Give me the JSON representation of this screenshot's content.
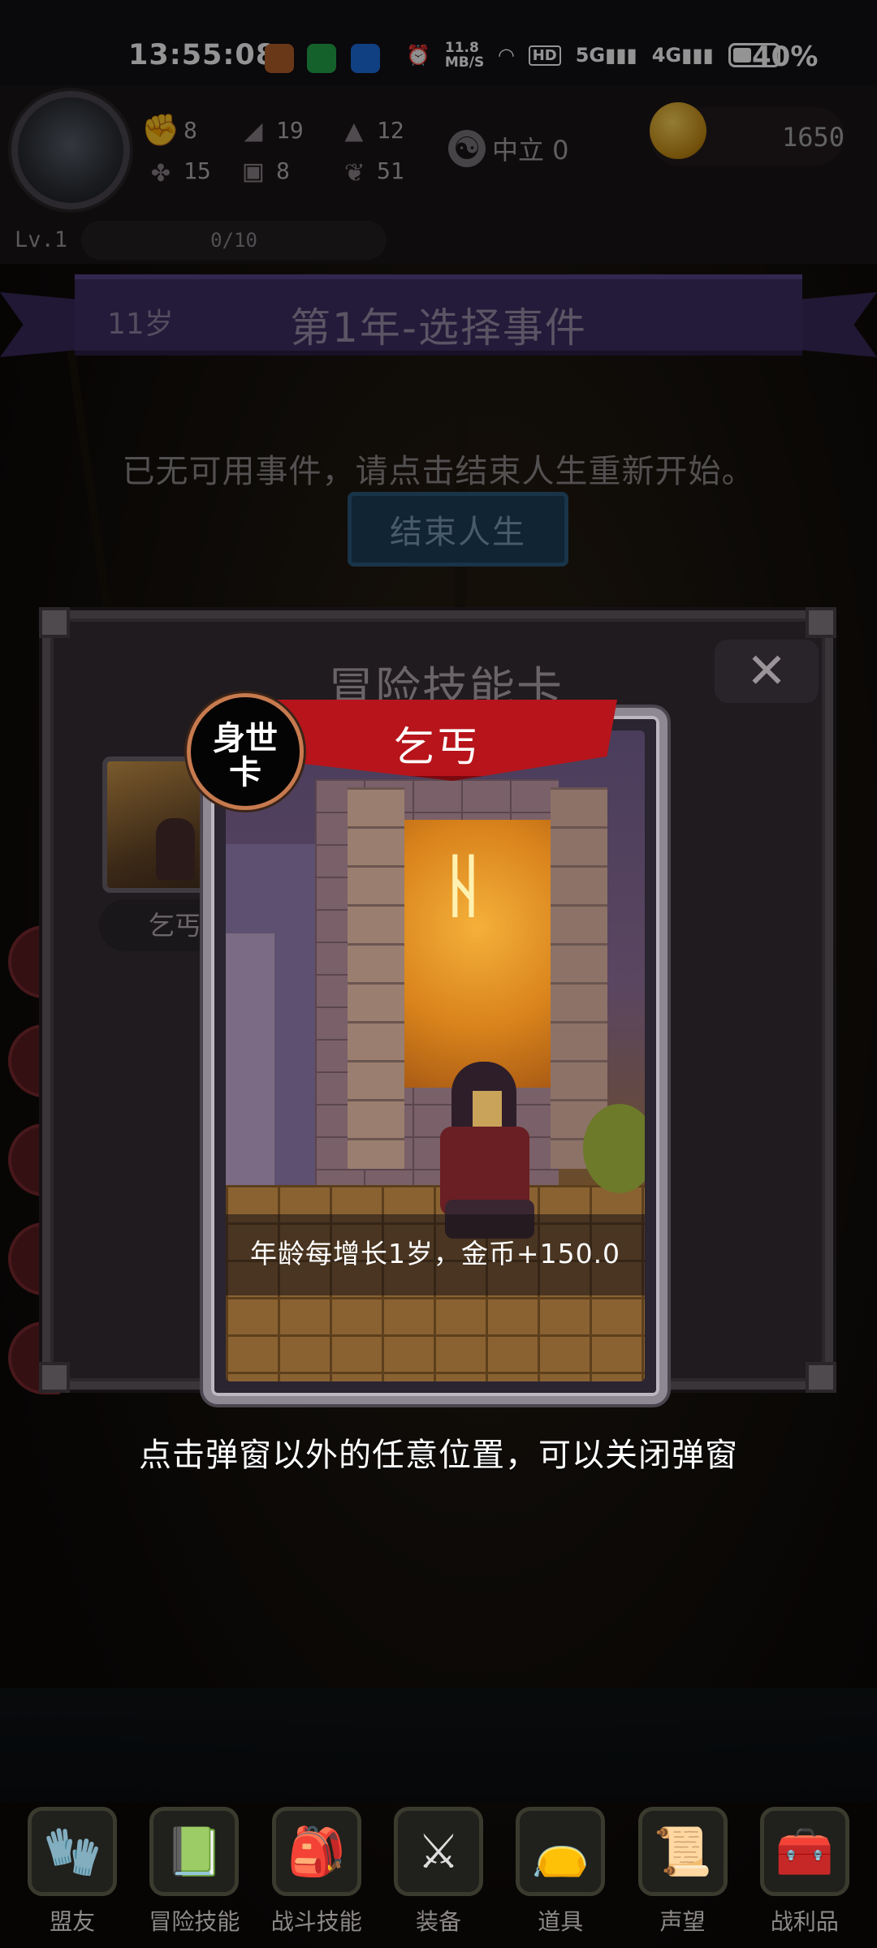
{
  "status_bar": {
    "time": "13:55:08",
    "net_speed": "11.8",
    "net_unit": "MB/S",
    "hd": "HD",
    "sig1": "5G",
    "sig2": "4G",
    "battery": "40%"
  },
  "player": {
    "level": "Lv.1",
    "xp": "0/10",
    "stats": [
      {
        "icon": "fist-icon",
        "glyph": "✊",
        "value": "8"
      },
      {
        "icon": "boot-icon",
        "glyph": "◢",
        "value": "19"
      },
      {
        "icon": "wizard-hat-icon",
        "glyph": "▲",
        "value": "12"
      },
      {
        "icon": "clover-icon",
        "glyph": "✤",
        "value": "15"
      },
      {
        "icon": "armor-icon",
        "glyph": "▣",
        "value": "8"
      },
      {
        "icon": "wing-icon",
        "glyph": "❦",
        "value": "51"
      }
    ],
    "alignment": "中立 0",
    "gold": "1650"
  },
  "banner": {
    "age": "11岁",
    "title": "第1年-选择事件"
  },
  "main": {
    "hint": "已无可用事件，请点击结束人生重新开始。",
    "end_button": "结束人生"
  },
  "modal": {
    "title": "冒险技能卡",
    "close_glyph": "✕",
    "thumb_label": "乞丐",
    "card": {
      "badge": "身世卡",
      "badge_line1": "身世",
      "badge_line2": "卡",
      "name": "乞丐",
      "description": "年龄每增长1岁，金币+150.0"
    }
  },
  "close_hint": "点击弹窗以外的任意位置，可以关闭弹窗",
  "nav": [
    {
      "label": "盟友",
      "icon": "gloves-icon",
      "glyph": "🧤"
    },
    {
      "label": "冒险技能",
      "icon": "book-icon",
      "glyph": "📗"
    },
    {
      "label": "战斗技能",
      "icon": "backpack-icon",
      "glyph": "🎒"
    },
    {
      "label": "装备",
      "icon": "crossed-swords-icon",
      "glyph": "⚔"
    },
    {
      "label": "道具",
      "icon": "bag-icon",
      "glyph": "👝"
    },
    {
      "label": "声望",
      "icon": "scroll-icon",
      "glyph": "📜"
    },
    {
      "label": "战利品",
      "icon": "treasure-chest-icon",
      "glyph": "🧰"
    }
  ]
}
